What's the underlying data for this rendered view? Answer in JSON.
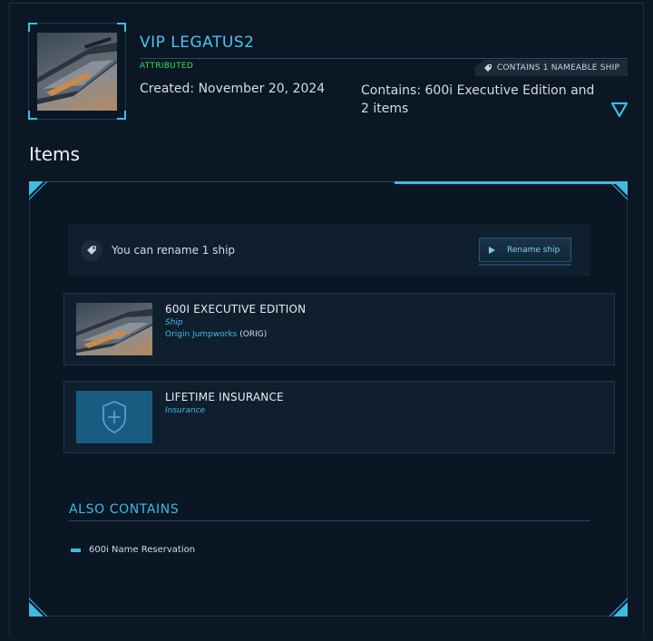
{
  "package": {
    "title": "VIP LEGATUS2",
    "status": "ATTRIBUTED",
    "status_color": "#2de05a",
    "badge": "CONTAINS 1 NAMEABLE SHIP",
    "created": "Created: November 20, 2024",
    "contains": "Contains: 600i Executive Edition and 2 items",
    "expand_icon": "chevron-down-triangle-icon"
  },
  "items_heading": "Items",
  "rename": {
    "message": "You can rename 1 ship",
    "button_label": "Rename ship"
  },
  "items": [
    {
      "name": "600I EXECUTIVE EDITION",
      "type": "Ship",
      "maker": "Origin Jumpworks",
      "maker_code": "(ORIG)"
    },
    {
      "name": "LIFETIME INSURANCE",
      "type": "Insurance"
    }
  ],
  "also_contains": {
    "heading": "ALSO CONTAINS",
    "items": [
      "600i Name Reservation"
    ]
  },
  "colors": {
    "accent": "#3bbde3",
    "background": "#0b1725"
  }
}
